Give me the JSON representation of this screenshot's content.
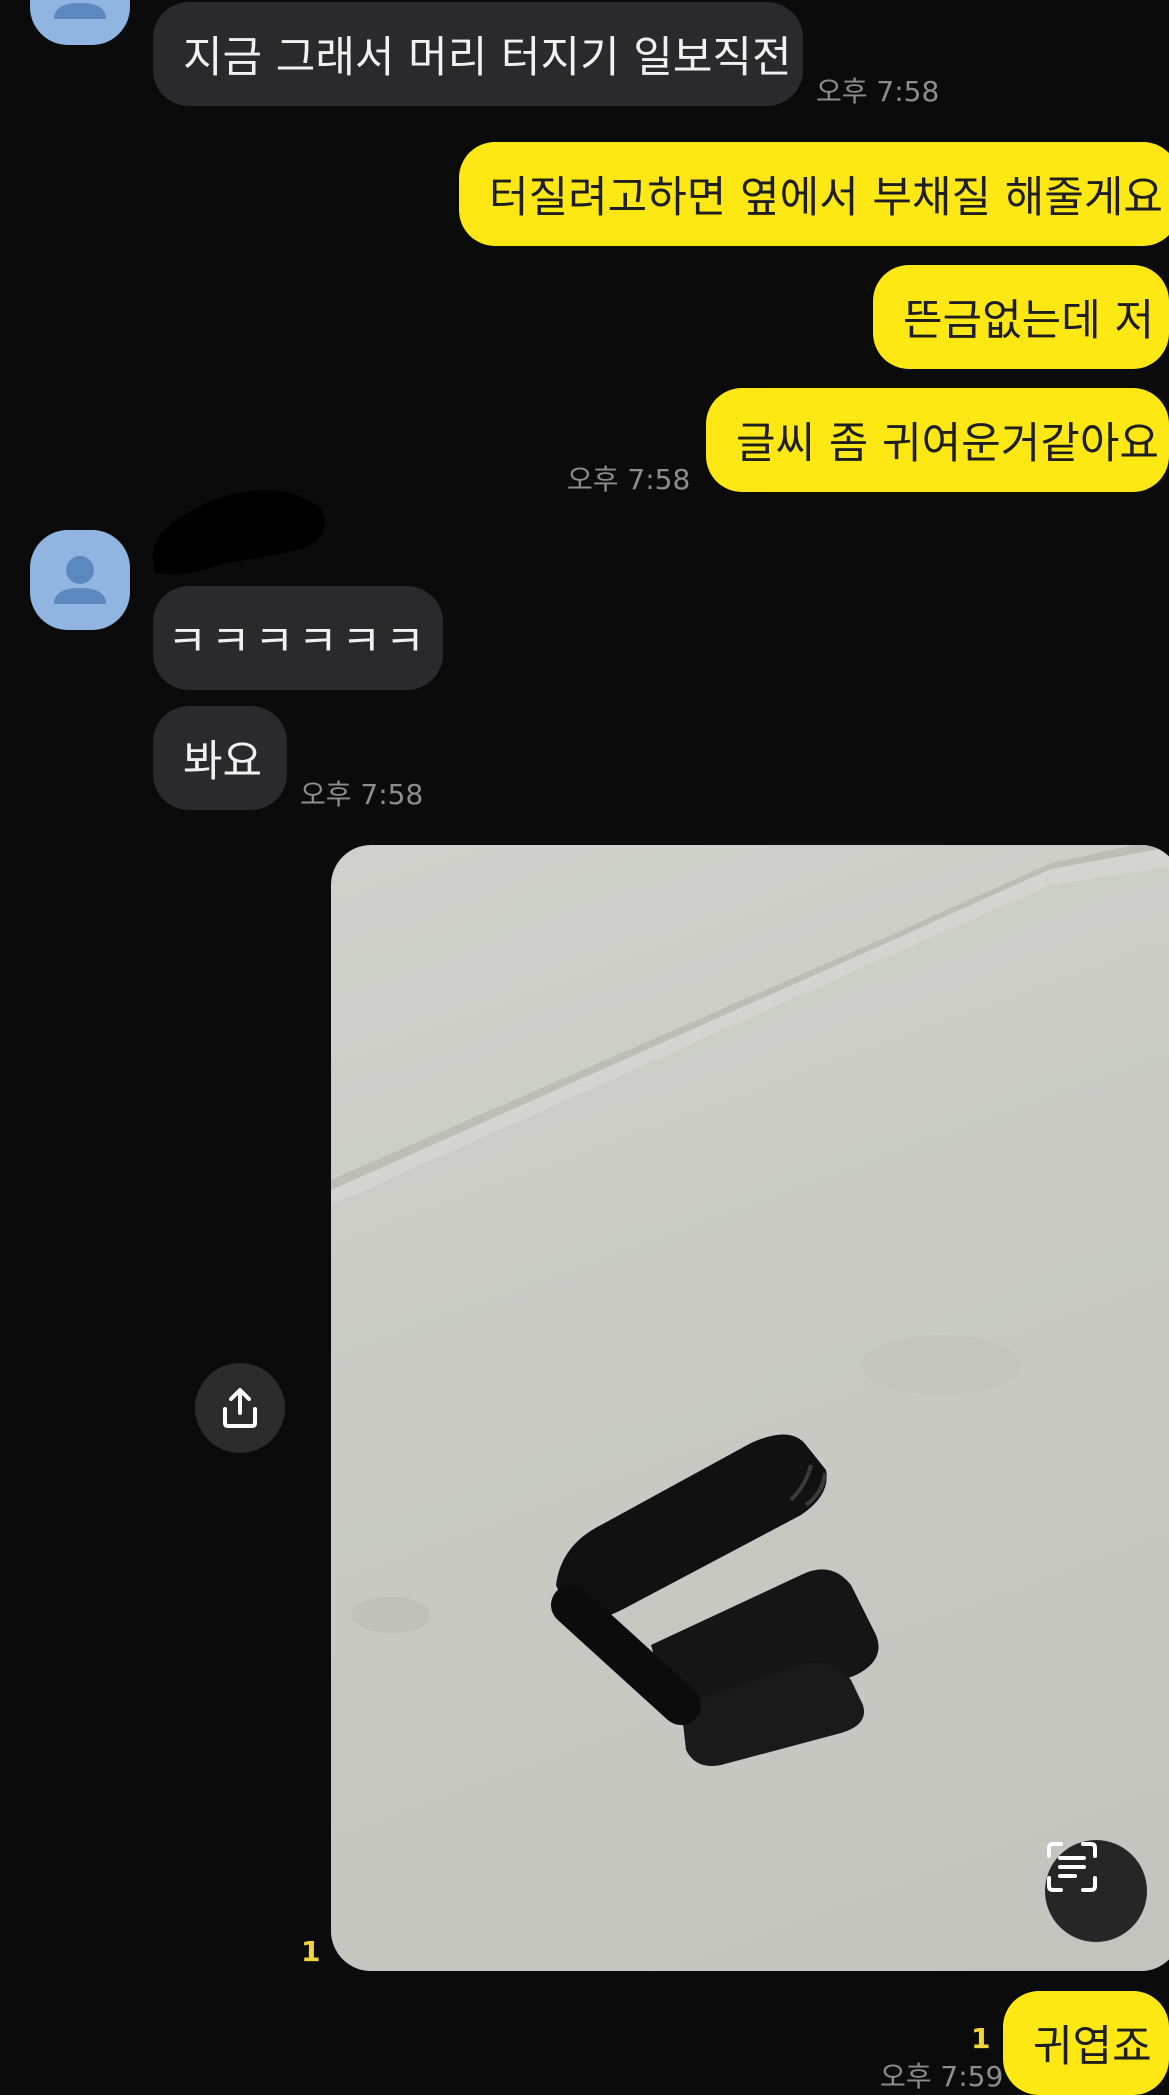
{
  "messages": {
    "m1": {
      "text": "지금 그래서 머리 터지기 일보직전",
      "time": "오후 7:58"
    },
    "m2": {
      "text": "터질려고하면 옆에서 부채질 해줄게요"
    },
    "m3": {
      "text": "뜬금없는데 저"
    },
    "m4": {
      "text": "글씨 좀 귀여운거같아요",
      "time": "오후 7:58"
    },
    "m5": {
      "text": "ㅋㅋㅋㅋㅋㅋ"
    },
    "m6": {
      "text": "봐요",
      "time": "오후 7:58"
    },
    "photo": {
      "unread": "1"
    },
    "m7": {
      "text": "귀엽죠",
      "unread": "1",
      "time": "오후 7:59"
    }
  },
  "icons": {
    "avatar": "person-icon",
    "share": "share-upload-icon",
    "text_scan": "text-scan-icon"
  },
  "colors": {
    "background": "#0b0b0b",
    "incoming_bubble": "#2a2a2c",
    "outgoing_bubble": "#fde814",
    "unread": "#f3d43c"
  }
}
